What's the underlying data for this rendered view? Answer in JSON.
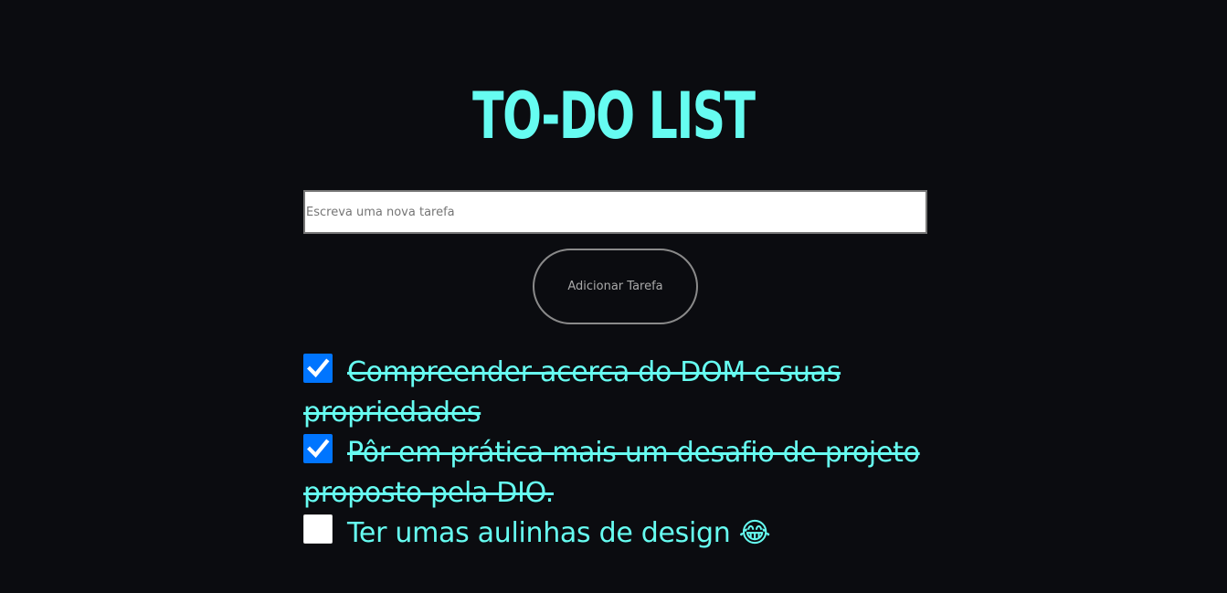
{
  "theme": {
    "background": "#0b0c10",
    "accent": "#66fcf1",
    "checkbox_checked": "#0075ff"
  },
  "header": {
    "title": "TO-DO LIST"
  },
  "form": {
    "input_placeholder": "Escreva uma nova tarefa",
    "input_value": "",
    "add_button_label": "Adicionar Tarefa"
  },
  "tasks": [
    {
      "text": "Compreender acerca do DOM e suas propriedades",
      "done": true
    },
    {
      "text": "Pôr em prática mais um desafio de projeto proposto pela DIO.",
      "done": true
    },
    {
      "text": "Ter umas aulinhas de design 😂",
      "done": false
    }
  ]
}
